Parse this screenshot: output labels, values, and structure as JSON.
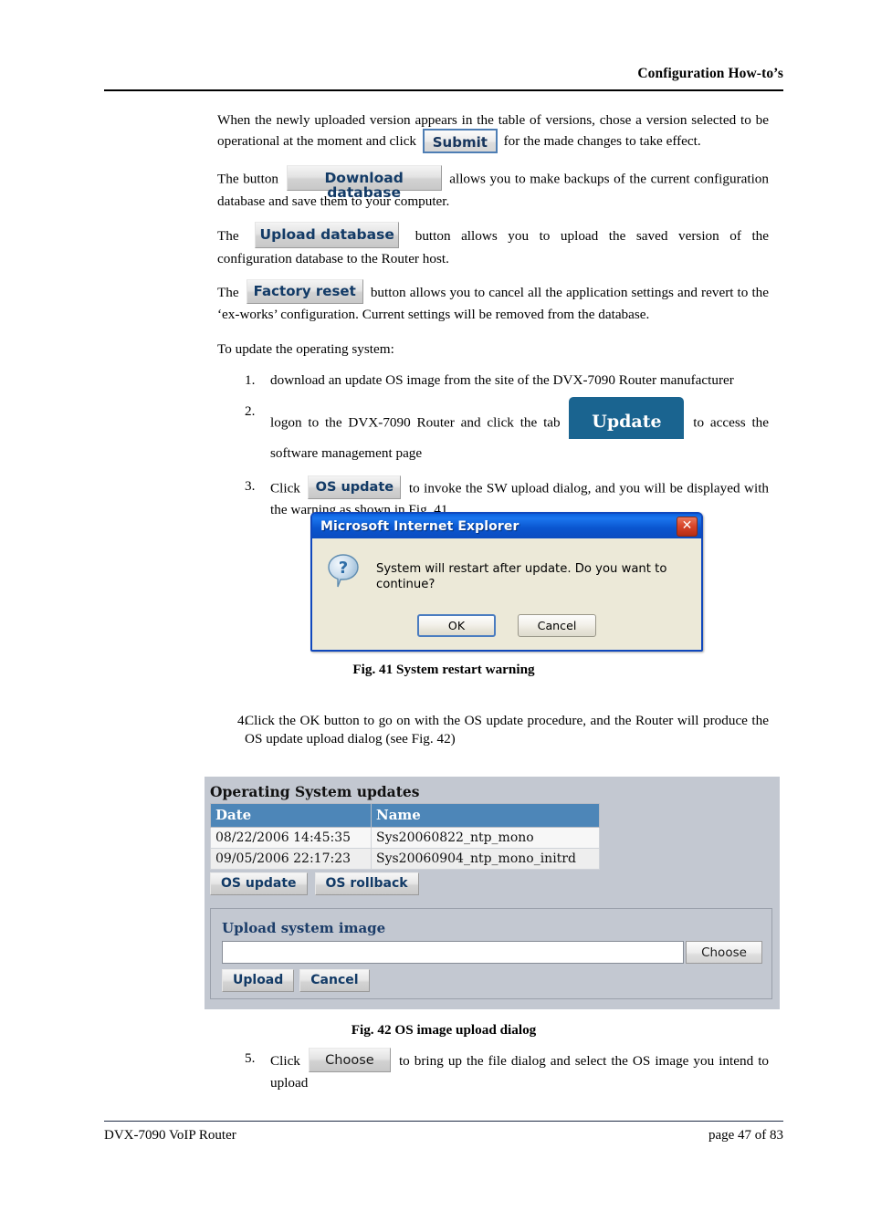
{
  "header": {
    "title": "Configuration How-to’s"
  },
  "intro": {
    "para1_before": "When the newly uploaded version appears in the table of versions, chose a version selected to be operational at the moment and click",
    "submit_label": "Submit",
    "para1_after": "for the made changes to take effect.",
    "para2_before": "The button",
    "download_db_label": "Download database",
    "para2_after": "allows you to make backups of the current configuration database and save them to your computer.",
    "para3_before": "The",
    "upload_db_label": "Upload database",
    "para3_after": "button allows you to upload the saved version of the configuration database to the Router host.",
    "para4_before": "The",
    "factory_reset_label": "Factory reset",
    "para4_after": "button allows you to cancel all the application settings and revert to the ‘ex-works’ configuration. Current settings will be removed from the database.",
    "lead_in": "To update the operating system:"
  },
  "steps": [
    {
      "num": "1.",
      "text_before": "download an update OS image from the site of the DVX-7090 Router manufacturer",
      "button": null,
      "text_after": ""
    },
    {
      "num": "2.",
      "text_before": "logon to the DVX-7090 Router and click the tab",
      "button": "Update",
      "text_after": "to access the software management page"
    },
    {
      "num": "3.",
      "text_before": "Click",
      "button": "OS update",
      "text_after": "to invoke the SW upload dialog, and you will be displayed with the warning as shown in Fig. 41"
    },
    {
      "num": "4.",
      "text_before": "Click the OK button to go on with the OS update procedure, and the Router will produce the OS update upload dialog (see Fig. 42)",
      "button": null,
      "text_after": ""
    },
    {
      "num": "5.",
      "text_before": "Click",
      "button": "Choose",
      "text_after": "to bring up the file dialog and select the OS image you intend to upload"
    }
  ],
  "dialog": {
    "title": "Microsoft Internet Explorer",
    "close_label": "✕",
    "icon": "question-icon",
    "message": "System will restart after update. Do you want to continue?",
    "ok_label": "OK",
    "cancel_label": "Cancel"
  },
  "fig41_caption": "Fig. 41 System restart warning",
  "fig42_caption": "Fig. 42 OS image upload dialog",
  "os_panel": {
    "title": "Operating System updates",
    "columns": [
      "Date",
      "Name"
    ],
    "rows": [
      [
        "08/22/2006 14:45:35",
        "Sys20060822_ntp_mono"
      ],
      [
        "09/05/2006 22:17:23",
        "Sys20060904_ntp_mono_initrd"
      ]
    ],
    "os_update_label": "OS update",
    "os_rollback_label": "OS rollback",
    "upload_legend": "Upload system image",
    "upload_input_value": "",
    "choose_label": "Choose",
    "upload_label": "Upload",
    "cancel_label": "Cancel"
  },
  "footer": {
    "left": "DVX-7090 VoIP Router",
    "right": "page 47 of 83"
  },
  "colors": {
    "table_header_blue": "#4d86b8",
    "panel_bg": "#c3c8d1",
    "update_tab_blue": "#1a6490",
    "button_text_blue": "#123a66",
    "dialog_title_blue": "#0a55cf",
    "dialog_body_beige": "#ece9d8",
    "close_button_red": "#d9462b"
  }
}
